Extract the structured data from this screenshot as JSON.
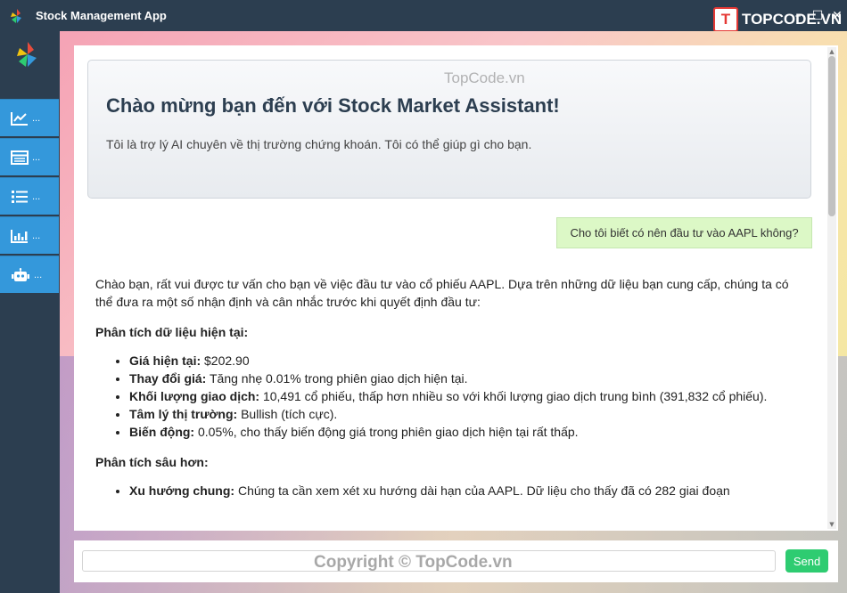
{
  "app": {
    "title": "Stock Management App",
    "brand_watermark": "TOPCODE.VN",
    "brand_badge": "T",
    "controls": [
      "–",
      "☐",
      "✕"
    ]
  },
  "sidebar": {
    "items": [
      {
        "icon": "line-chart-icon",
        "label": "..."
      },
      {
        "icon": "table-list-icon",
        "label": "..."
      },
      {
        "icon": "list-icon",
        "label": "..."
      },
      {
        "icon": "bar-chart-icon",
        "label": "..."
      },
      {
        "icon": "robot-icon",
        "label": "..."
      }
    ]
  },
  "chat": {
    "welcome_title": "Chào mừng bạn đến với Stock Market Assistant!",
    "welcome_subtitle": "Tôi là trợ lý AI chuyên về thị trường chứng khoán. Tôi có thể giúp gì cho bạn.",
    "user_message": "Cho tôi biết có nên đầu tư vào AAPL không?",
    "bot": {
      "intro": "Chào bạn, rất vui được tư vấn cho bạn về việc đầu tư vào cổ phiếu AAPL. Dựa trên những dữ liệu bạn cung cấp, chúng ta có thể đưa ra một số nhận định và cân nhắc trước khi quyết định đầu tư:",
      "section1_title": "Phân tích dữ liệu hiện tại:",
      "section1_items": [
        {
          "label": "Giá hiện tại:",
          "text": " $202.90"
        },
        {
          "label": "Thay đổi giá:",
          "text": " Tăng nhẹ 0.01% trong phiên giao dịch hiện tại."
        },
        {
          "label": "Khối lượng giao dịch:",
          "text": " 10,491 cổ phiếu, thấp hơn nhiều so với khối lượng giao dịch trung bình (391,832 cổ phiếu)."
        },
        {
          "label": "Tâm lý thị trường:",
          "text": " Bullish (tích cực)."
        },
        {
          "label": "Biến động:",
          "text": " 0.05%, cho thấy biến động giá trong phiên giao dịch hiện tại rất thấp."
        }
      ],
      "section2_title": "Phân tích sâu hơn:",
      "section2_items": [
        {
          "label": "Xu hướng chung:",
          "text": " Chúng ta cần xem xét xu hướng dài hạn của AAPL. Dữ liệu cho thấy đã có 282 giai đoạn"
        }
      ]
    }
  },
  "input": {
    "placeholder": "",
    "value": "",
    "send_label": "Send"
  },
  "watermarks": {
    "top": "TopCode.vn",
    "bottom": "Copyright © TopCode.vn"
  },
  "colors": {
    "titlebar": "#2c3e50",
    "sidebar_item": "#3498db",
    "send_button": "#2ecc71",
    "user_bubble": "#dcf8c6"
  }
}
